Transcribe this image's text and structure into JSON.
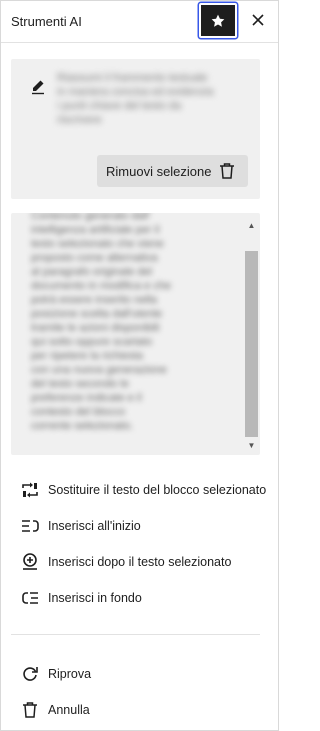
{
  "header": {
    "title": "Strumenti AI",
    "pin_icon": "star-icon",
    "close_icon": "close-icon"
  },
  "selection": {
    "icon": "pencil-icon",
    "text_lines": [
      "Riassumi il frammento testuale",
      "in maniera concisa ed evidenzia",
      "i punti chiave del testo da",
      "riscrivere"
    ],
    "remove_label": "Rimuovi selezione",
    "remove_icon": "trash-icon"
  },
  "preview": {
    "lines": [
      "Contenuto generato dall'",
      "intelligenza artificiale per il",
      "testo selezionato che viene",
      "proposto come alternativa",
      "al paragrafo originale del",
      "documento in modifica e che",
      "potrà essere inserito nella",
      "posizione scelta dall'utente",
      "tramite le azioni disponibili",
      "qui sotto oppure scartato",
      "per ripetere la richiesta",
      "con una nuova generazione",
      "del testo secondo le",
      "preferenze indicate e il",
      "contesto del blocco",
      "corrente selezionato."
    ]
  },
  "actions": [
    {
      "id": "replace",
      "label": "Sostituire il testo del blocco selezionato",
      "icon": "replace-icon"
    },
    {
      "id": "insert-start",
      "label": "Inserisci all'inizio",
      "icon": "insert-start-icon"
    },
    {
      "id": "insert-after",
      "label": "Inserisci dopo il testo selezionato",
      "icon": "insert-after-icon"
    },
    {
      "id": "insert-end",
      "label": "Inserisci in fondo",
      "icon": "insert-end-icon"
    },
    {
      "id": "retry",
      "label": "Riprova",
      "icon": "retry-icon"
    },
    {
      "id": "cancel",
      "label": "Annulla",
      "icon": "trash-icon"
    }
  ]
}
